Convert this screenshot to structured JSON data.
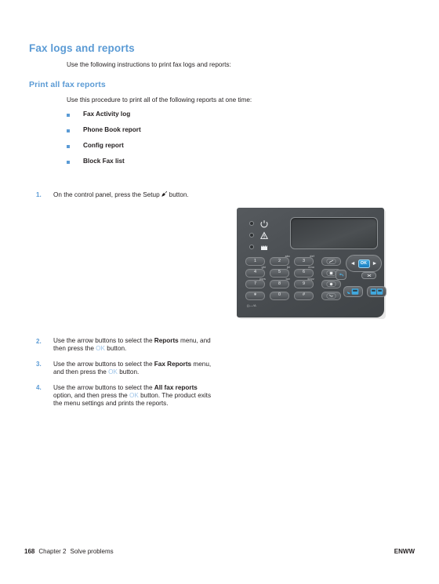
{
  "document": {
    "heading": "Fax logs and reports",
    "intro": "Use the following instructions to print fax logs and reports:",
    "subheading": "Print all fax reports",
    "intro2": "Use this procedure to print all of the following reports at one time:",
    "bullets": [
      "Fax Activity log",
      "Phone Book report",
      "Config report",
      "Block Fax list"
    ],
    "steps": [
      {
        "number": "1.",
        "text_before": "On the control panel, press the Setup",
        "icon": "wrench-icon",
        "text_after": "button."
      },
      {
        "number": "2.",
        "part1": "Use the arrow buttons to select the ",
        "bold1": "Reports",
        "part2": " menu, and then press the ",
        "key": "OK",
        "part3": " button."
      },
      {
        "number": "3.",
        "part1": "Use the arrow buttons to select the ",
        "bold1": "Fax Reports",
        "part2": " menu, and then press the ",
        "key": "OK",
        "part3": " button."
      },
      {
        "number": "4.",
        "part1": "Use the arrow buttons to select the ",
        "bold1": "All fax reports",
        "part2": " option, and then press the ",
        "key": "OK",
        "part3": " button. The product exits the menu settings and prints the reports."
      }
    ]
  },
  "control_panel": {
    "leds": [
      {
        "name": "ready-led",
        "icon": "power-circle-icon"
      },
      {
        "name": "attention-led",
        "icon": "warning-triangle-icon"
      },
      {
        "name": "toner-led",
        "icon": "toner-cartridge-icon"
      }
    ],
    "display": "",
    "keypad": [
      {
        "digit": "1",
        "letters": ""
      },
      {
        "digit": "2",
        "letters": "abc"
      },
      {
        "digit": "3",
        "letters": "def"
      },
      {
        "digit": "4",
        "letters": "ghi"
      },
      {
        "digit": "5",
        "letters": "jkl"
      },
      {
        "digit": "6",
        "letters": "mno"
      },
      {
        "digit": "7",
        "letters": "pqrs"
      },
      {
        "digit": "8",
        "letters": "tuv"
      },
      {
        "digit": "9",
        "letters": "wxyz"
      },
      {
        "digit": "∗",
        "letters": ""
      },
      {
        "digit": "0",
        "letters": ""
      },
      {
        "digit": "#",
        "letters": ""
      }
    ],
    "keypad_note": "()—/Δ",
    "function_keys": [
      "redial-key",
      "contrast-key",
      "resolution-key",
      "phonebook-key"
    ],
    "nav": {
      "left_arrow": "◄",
      "ok_label": "OK",
      "right_arrow": "►"
    },
    "back_button": "back-arrow-icon",
    "cancel_button": "cancel-x-icon",
    "fax_start_button": "fax-start-icon",
    "copy_start_button": "copy-start-icon",
    "colors": {
      "accent_blue": "#1b7fc0",
      "panel_body": "#4a4e52"
    }
  },
  "footer": {
    "page_number": "168",
    "chapter": "Chapter 2",
    "chapter_title": "Solve problems",
    "locale": "ENWW"
  },
  "theme": {
    "heading_blue": "#5b9bd5",
    "body_text": "#231f20",
    "key_blue": "#9fc5e8"
  }
}
